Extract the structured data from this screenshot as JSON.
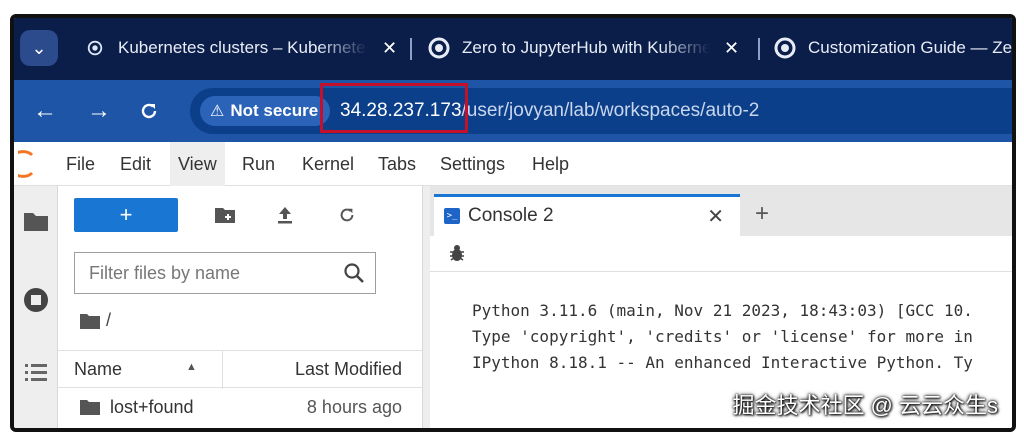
{
  "browser": {
    "tabs": [
      {
        "title": "Kubernetes clusters – Kubernetes",
        "close": "✕"
      },
      {
        "title": "Zero to JupyterHub with Kubernetes",
        "close": "✕"
      },
      {
        "title": "Customization Guide — Ze",
        "close": ""
      }
    ],
    "security_label": "Not secure",
    "url_host": "34.28.237.173",
    "url_path": "/user/jovyan/lab/workspaces/auto-2",
    "highlight_color": "#c4102b"
  },
  "menubar": {
    "items": [
      "File",
      "Edit",
      "View",
      "Run",
      "Kernel",
      "Tabs",
      "Settings",
      "Help"
    ],
    "active": "View"
  },
  "filebrowser": {
    "new_label": "+",
    "filter_placeholder": "Filter files by name",
    "breadcrumb": "/",
    "columns": {
      "name": "Name",
      "modified": "Last Modified"
    },
    "files": [
      {
        "name": "lost+found",
        "modified": "8 hours ago",
        "icon": "folder-icon"
      }
    ]
  },
  "main": {
    "tab_title": "Console 2",
    "tab_close": "✕",
    "add_tab": "+",
    "console_lines": [
      "Python 3.11.6 (main, Nov 21 2023, 18:43:03) [GCC 10.",
      "Type 'copyright', 'credits' or 'license' for more in",
      "IPython 8.18.1 -- An enhanced Interactive Python. Ty"
    ]
  },
  "watermark": "掘金技术社区 @ 云云众生s",
  "colors": {
    "accent": "#1976d2",
    "chrome_dark": "#0b1e4a",
    "address_bar": "#1e55a6"
  }
}
